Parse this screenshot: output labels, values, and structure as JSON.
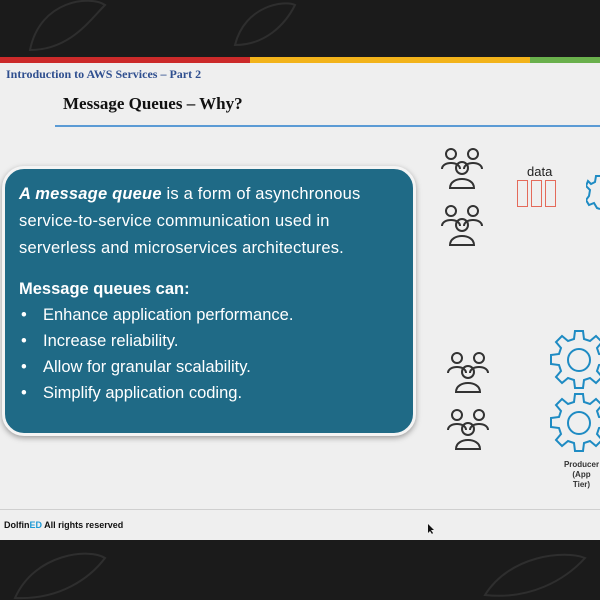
{
  "header": {
    "course_title": "Introduction to AWS Services – Part 2",
    "slide_title": "Message Queues – Why?"
  },
  "colors": {
    "top_bar": [
      "#cc2a2a",
      "#f2b31b",
      "#6ab04c"
    ],
    "card_background": "#1f6a86",
    "title_rule": "#5b9bd5",
    "data_boxes": "#e46a5a"
  },
  "card": {
    "intro_emphasis": "A message queue",
    "intro_line1_rest": " is a form of asynchronous",
    "intro_line2": "service-to-service communication used in",
    "intro_line3": "serverless and microservices architectures.",
    "subheading": "Message queues can:",
    "bullets": [
      "Enhance application performance.",
      "Increase reliability.",
      "Allow for granular scalability.",
      "Simplify application coding."
    ]
  },
  "diagram": {
    "data_label": "data",
    "producer_label_line1": "Producer",
    "producer_label_line2": "(App Tier)",
    "icons": [
      "users-icon",
      "users-icon",
      "users-icon",
      "users-icon",
      "gear-icon",
      "gear-icon",
      "gear-icon"
    ]
  },
  "footer": {
    "brand_part1": "Dolfin",
    "brand_part2": "ED",
    "rights_text": " All rights reserved"
  }
}
